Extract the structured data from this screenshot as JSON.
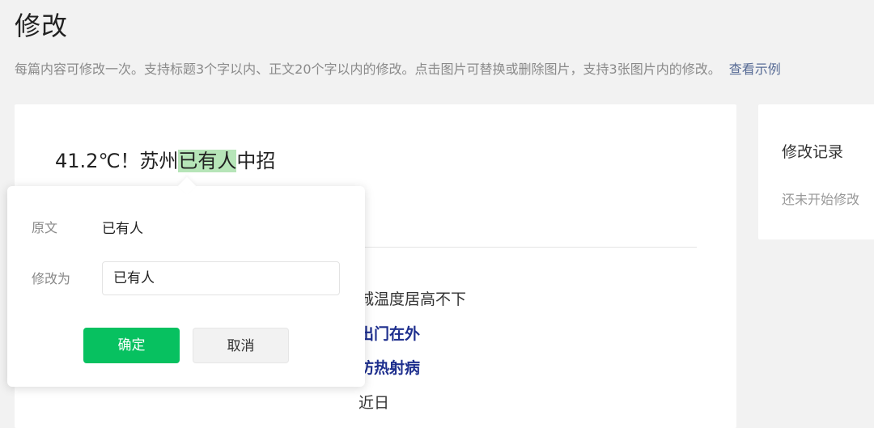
{
  "header": {
    "title": "修改",
    "hint": "每篇内容可修改一次。支持标题3个字以内、正文20个字以内的修改。点击图片可替换或删除图片，支持3张图片内的修改。",
    "example_link": "查看示例"
  },
  "article": {
    "title_before": "41.2℃！苏州",
    "title_highlight": "已有人",
    "title_after": "中招",
    "body_lines": [
      {
        "text": "城温度居高不下",
        "style": "plain"
      },
      {
        "text": "出门在外",
        "style": "bold"
      },
      {
        "text": "防热射病",
        "style": "bold"
      },
      {
        "text": "近日",
        "style": "plain"
      }
    ]
  },
  "record": {
    "title": "修改记录",
    "empty_text": "还未开始修改"
  },
  "popover": {
    "original_label": "原文",
    "original_value": "已有人",
    "edit_label": "修改为",
    "edit_value": "已有人",
    "confirm_label": "确定",
    "cancel_label": "取消"
  },
  "colors": {
    "accent_green": "#07c160",
    "highlight": "#b6e5b8",
    "link": "#576b95",
    "bold_text": "#1e2f8e"
  }
}
